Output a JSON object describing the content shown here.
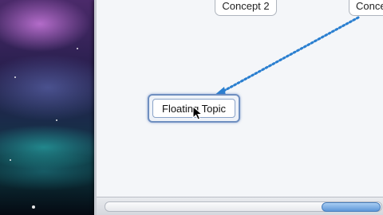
{
  "canvas": {
    "nodes": {
      "concept_2": "Concept 2",
      "concept_partial": "Conce",
      "floating_topic": "Floating Topic"
    },
    "link_color": "#2a7fd0"
  },
  "icons": {
    "cursor": "arrow-cursor-icon",
    "link_arrow": "link-arrowhead-icon"
  }
}
